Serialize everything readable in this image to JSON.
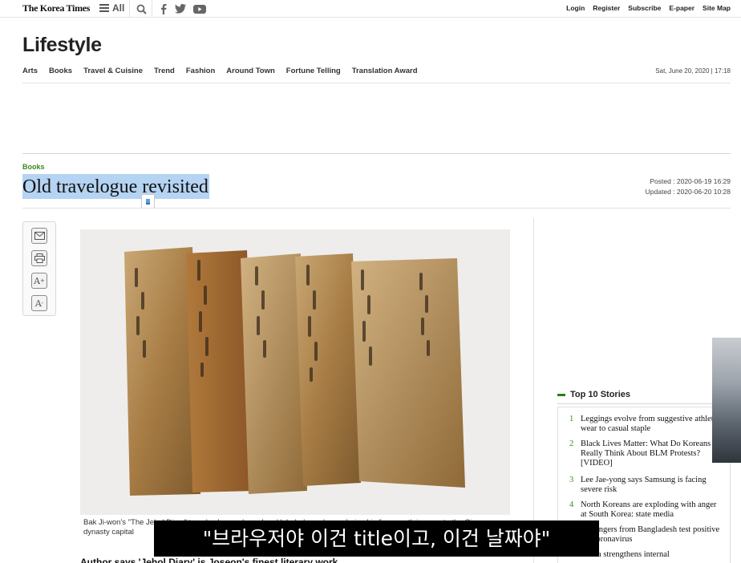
{
  "header": {
    "logo": "The Korea Times",
    "menu_label": "All",
    "links": [
      "Login",
      "Register",
      "Subscribe",
      "E-paper",
      "Site Map"
    ]
  },
  "section": {
    "title": "Lifestyle",
    "nav": [
      "Arts",
      "Books",
      "Travel & Cuisine",
      "Trend",
      "Fashion",
      "Around Town",
      "Fortune Telling",
      "Translation Award"
    ],
    "date": "Sat, June 20, 2020 | 17:18"
  },
  "article": {
    "category": "Books",
    "headline": "Old travelogue revisited",
    "posted": "Posted : 2020-06-19 16:29",
    "updated": "Updated : 2020-06-20 10:28",
    "caption": "Bak Ji-won's \"The Jehol Diary\" travel volumes, bound and labeled, as shown during his five-month journey to the Qing dynasty capital",
    "subhead": "Author says 'Jehol Diary' is Joseon's finest literary work"
  },
  "tools": [
    "email-icon",
    "print-icon",
    "font-increase-icon",
    "font-decrease-icon"
  ],
  "top_stories": {
    "title": "Top 10 Stories",
    "items": [
      {
        "num": "1",
        "text": "Leggings evolve from suggestive athletic wear to casual staple"
      },
      {
        "num": "2",
        "text": "Black Lives Matter: What Do Koreans Really Think About BLM Protests? [VIDEO]"
      },
      {
        "num": "3",
        "text": "Lee Jae-yong says Samsung is facing severe risk"
      },
      {
        "num": "4",
        "text": "North Koreans are exploding with anger at South Korea: state media"
      },
      {
        "num": "5",
        "text": "passengers from Bangladesh test positive for coronavirus"
      },
      {
        "num": "6",
        "text": "Korea strengthens internal"
      }
    ]
  },
  "overlay": {
    "subtitle": "\"브라우저야 이건 title이고, 이건 날짜야\""
  }
}
